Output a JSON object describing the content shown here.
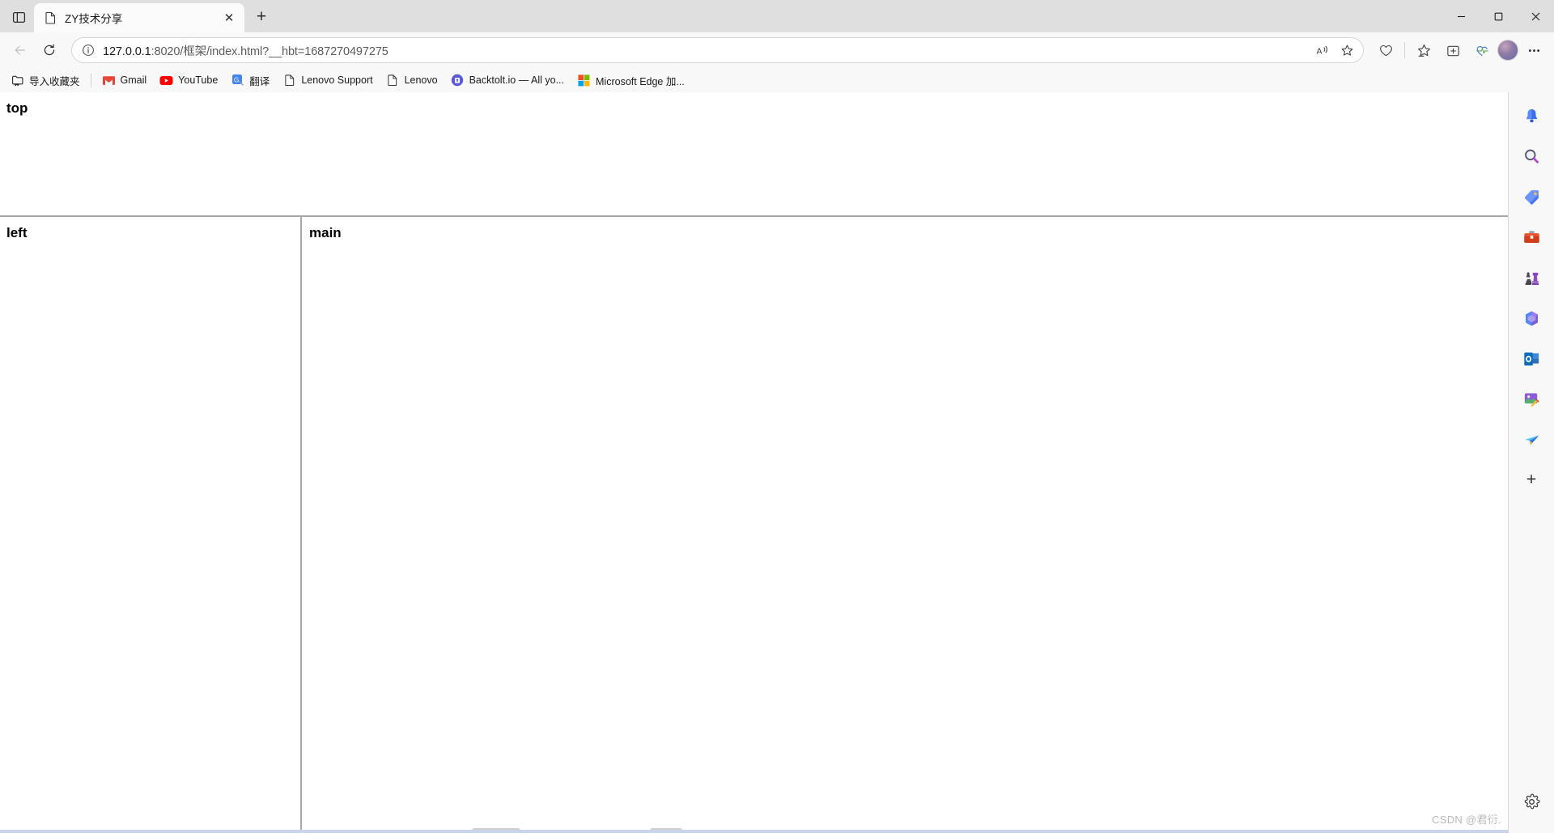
{
  "window": {
    "controls": {
      "minimize": "—",
      "maximize": "▢",
      "close": "✕"
    }
  },
  "tabstrip": {
    "tab_actions_label": "tab-actions",
    "tabs": [
      {
        "title": "ZY技术分享",
        "favicon": "document-icon",
        "close_label": "✕",
        "active": true
      }
    ],
    "new_tab_label": "+"
  },
  "toolbar": {
    "back_label": "back",
    "refresh_label": "refresh",
    "url_display": "127.0.0.1:8020/框架/index.html?__hbt=1687270497275",
    "url_host": "127.0.0.1",
    "url_rest": ":8020/框架/index.html?__hbt=1687270497275",
    "site_info_label": "site-information",
    "read_aloud_label": "A",
    "favorite_label": "add-to-favorites",
    "collections_label": "collections",
    "favorites_label": "favorites",
    "split_screen_label": "split-screen",
    "browser_essentials_label": "browser-essentials",
    "profile_label": "profile",
    "settings_label": "settings-and-more"
  },
  "bookmarks": [
    {
      "label": "导入收藏夹",
      "icon": "import-favorites-icon"
    },
    {
      "label": "Gmail",
      "icon": "gmail-icon"
    },
    {
      "label": "YouTube",
      "icon": "youtube-icon"
    },
    {
      "label": "翻译",
      "icon": "translate-icon"
    },
    {
      "label": "Lenovo Support",
      "icon": "document-icon"
    },
    {
      "label": "Lenovo",
      "icon": "document-icon"
    },
    {
      "label": "Backtolt.io — All yo...",
      "icon": "backtolt-icon"
    },
    {
      "label": "Microsoft Edge 加...",
      "icon": "microsoft-icon"
    }
  ],
  "page": {
    "frames": {
      "top": "top",
      "left": "left",
      "main": "main"
    }
  },
  "sidebar": {
    "items": [
      {
        "name": "notifications",
        "icon": "bell-icon"
      },
      {
        "name": "search",
        "icon": "search-icon"
      },
      {
        "name": "shopping",
        "icon": "tag-icon"
      },
      {
        "name": "tools",
        "icon": "toolbox-icon"
      },
      {
        "name": "games",
        "icon": "chess-icon"
      },
      {
        "name": "office",
        "icon": "microsoft365-icon"
      },
      {
        "name": "outlook",
        "icon": "outlook-icon"
      },
      {
        "name": "image-creator",
        "icon": "image-edit-icon"
      },
      {
        "name": "drop",
        "icon": "paper-plane-icon"
      }
    ],
    "add_label": "+",
    "customize_label": "customize-sidebar"
  },
  "watermark": "CSDN @君衍.",
  "colors": {
    "tabstrip_bg": "#dfdfdf",
    "toolbar_bg": "#f8f8f8",
    "tab_active_bg": "#fbfbfb",
    "frame_border": "#a8a8a8",
    "text": "#1b1b1b",
    "url_muted": "#5c5c5c",
    "watermark": "#b8b8b8"
  }
}
